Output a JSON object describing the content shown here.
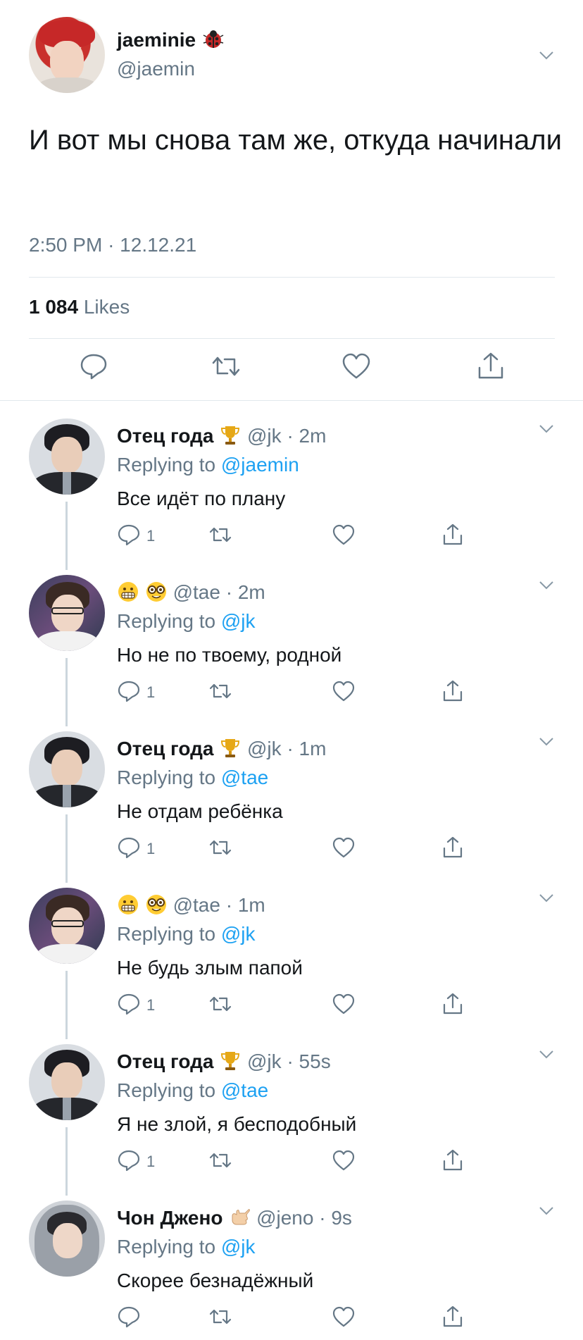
{
  "main_tweet": {
    "display_name": "jaeminie",
    "name_emoji": "ladybug-emoji",
    "handle": "@jaemin",
    "text": "И вот мы снова там же, откуда начинали",
    "time": "2:50 PM",
    "date": "12.12.21",
    "likes_count": "1 084",
    "likes_label": "Likes",
    "actions": [
      "reply-icon",
      "retweet-icon",
      "like-icon",
      "share-icon"
    ]
  },
  "replies": [
    {
      "display_name": "Отец года",
      "name_emoji": "trophy-emoji",
      "handle": "@jk",
      "time": "2m",
      "replying_prefix": "Replying to",
      "replying_to": "@jaemin",
      "text": "Все идёт по плану",
      "reply_count": "1"
    },
    {
      "display_name": "",
      "name_emoji": "grimacing-face-emoji, nerd-face-emoji",
      "handle": "@tae",
      "time": "2m",
      "replying_prefix": "Replying to",
      "replying_to": "@jk",
      "text": "Но не по твоему, родной",
      "reply_count": "1"
    },
    {
      "display_name": "Отец года",
      "name_emoji": "trophy-emoji",
      "handle": "@jk",
      "time": "1m",
      "replying_prefix": "Replying to",
      "replying_to": "@tae",
      "text": "Не отдам ребёнка",
      "reply_count": "1"
    },
    {
      "display_name": "",
      "name_emoji": "grimacing-face-emoji, nerd-face-emoji",
      "handle": "@tae",
      "time": "1m",
      "replying_prefix": "Replying to",
      "replying_to": "@jk",
      "text": "Не будь злым папой",
      "reply_count": "1"
    },
    {
      "display_name": "Отец года",
      "name_emoji": "trophy-emoji",
      "handle": "@jk",
      "time": "55s",
      "replying_prefix": "Replying to",
      "replying_to": "@tae",
      "text": "Я не злой, я бесподобный",
      "reply_count": "1"
    },
    {
      "display_name": "Чон Джено",
      "name_emoji": "call-me-hand-emoji",
      "handle": "@jeno",
      "time": "9s",
      "replying_prefix": "Replying to",
      "replying_to": "@jk",
      "text": "Скорее безнадёжный",
      "reply_count": ""
    }
  ],
  "separator": "·",
  "colors": {
    "text": "#14171a",
    "secondary": "#657786",
    "link": "#1da1f2",
    "divider": "#e1e8ed",
    "thread_line": "#ccd6dd"
  }
}
